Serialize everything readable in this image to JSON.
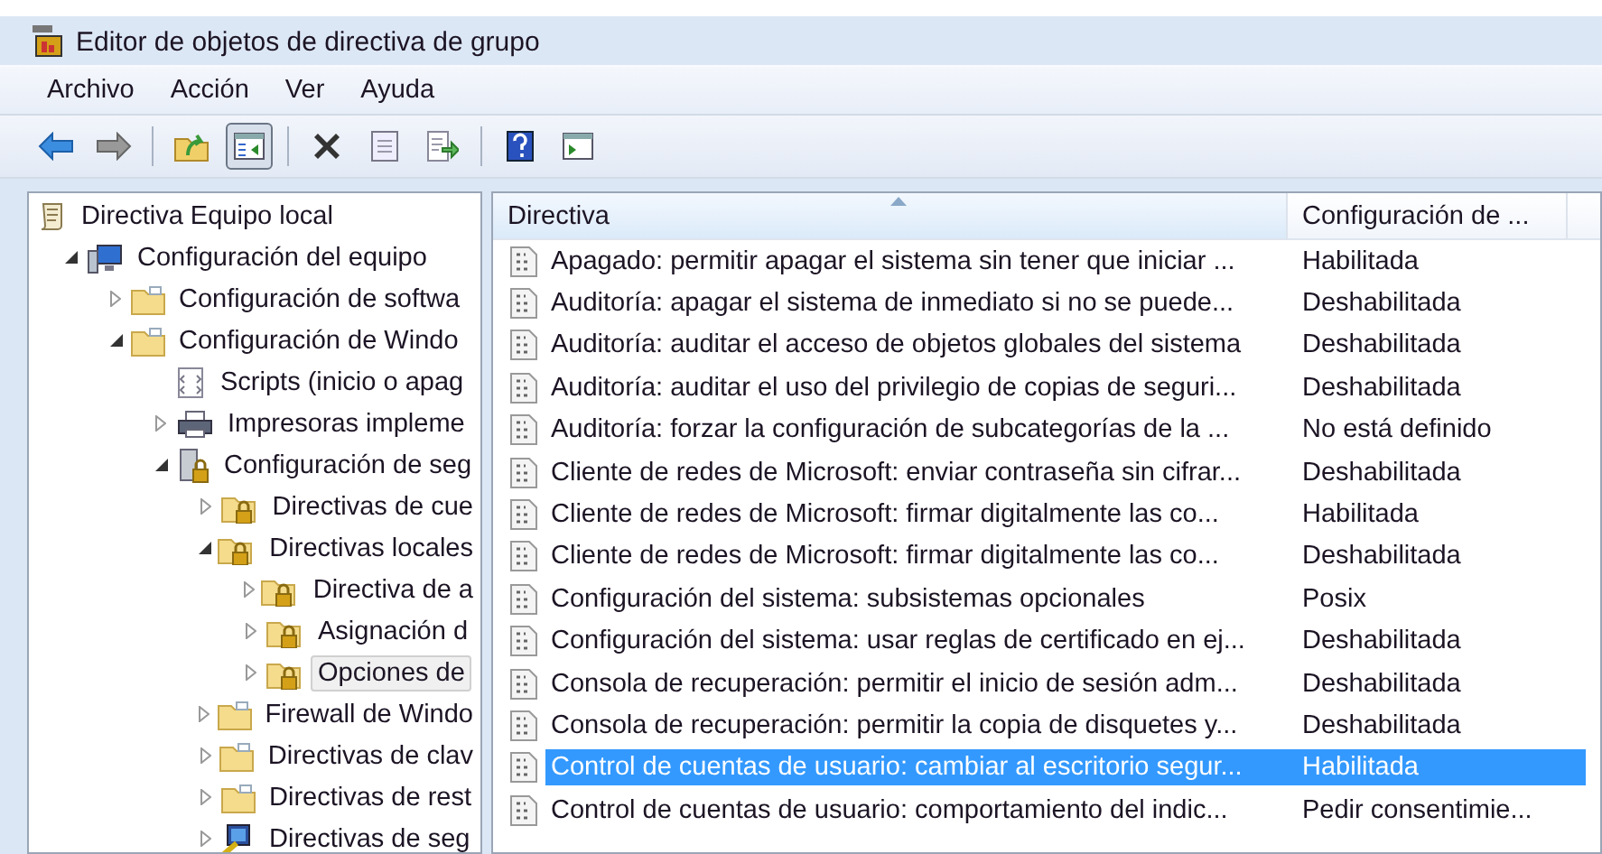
{
  "window": {
    "title": "Editor de objetos de directiva de grupo"
  },
  "menu": [
    "Archivo",
    "Acción",
    "Ver",
    "Ayuda"
  ],
  "toolbar": [
    {
      "kind": "back",
      "pressed": false
    },
    {
      "kind": "forward",
      "pressed": false
    },
    {
      "kind": "sep"
    },
    {
      "kind": "up",
      "pressed": false
    },
    {
      "kind": "tree",
      "pressed": true
    },
    {
      "kind": "sep"
    },
    {
      "kind": "delete",
      "pressed": false
    },
    {
      "kind": "properties",
      "pressed": false
    },
    {
      "kind": "export",
      "pressed": false
    },
    {
      "kind": "sep"
    },
    {
      "kind": "help",
      "pressed": false
    },
    {
      "kind": "view",
      "pressed": false
    }
  ],
  "tree": [
    {
      "label": "Directiva Equipo local",
      "kind": "scroll",
      "selected": false,
      "children": [
        {
          "label": "Configuración del equipo",
          "kind": "computer",
          "expanded": true,
          "selected": false,
          "children": [
            {
              "label": "Configuración de softwa",
              "kind": "folder",
              "expanded": false,
              "selected": false
            },
            {
              "label": "Configuración de Windo",
              "kind": "folder",
              "expanded": true,
              "selected": false,
              "children": [
                {
                  "label": "Scripts (inicio o apag",
                  "kind": "script",
                  "selected": false
                },
                {
                  "label": "Impresoras impleme",
                  "kind": "printer",
                  "expanded": false,
                  "selected": false
                },
                {
                  "label": "Configuración de seg",
                  "kind": "server",
                  "expanded": true,
                  "selected": false,
                  "children": [
                    {
                      "label": "Directivas de cue",
                      "kind": "lockfolder",
                      "expanded": false,
                      "selected": false
                    },
                    {
                      "label": "Directivas locales",
                      "kind": "lockfolder",
                      "expanded": true,
                      "selected": false,
                      "children": [
                        {
                          "label": "Directiva de a",
                          "kind": "lockfolder",
                          "expanded": false,
                          "selected": false
                        },
                        {
                          "label": "Asignación d",
                          "kind": "lockfolder",
                          "expanded": false,
                          "selected": false
                        },
                        {
                          "label": "Opciones de",
                          "kind": "lockfolder",
                          "expanded": false,
                          "selected": true
                        }
                      ]
                    },
                    {
                      "label": "Firewall de Windo",
                      "kind": "folder",
                      "expanded": false,
                      "selected": false
                    },
                    {
                      "label": "Directivas de clav",
                      "kind": "folder",
                      "expanded": false,
                      "selected": false
                    },
                    {
                      "label": "Directivas de rest",
                      "kind": "folder",
                      "expanded": false,
                      "selected": false
                    },
                    {
                      "label": "Directivas de seg",
                      "kind": "network",
                      "expanded": false,
                      "selected": false
                    }
                  ]
                }
              ]
            }
          ]
        }
      ]
    }
  ],
  "table": {
    "columns": [
      {
        "label": "Directiva",
        "sorted": true
      },
      {
        "label": "Configuración de ...",
        "sorted": false
      }
    ],
    "rows": [
      {
        "policy": "Apagado: permitir apagar el sistema sin tener que iniciar ...",
        "setting": "Habilitada",
        "selected": false
      },
      {
        "policy": "Auditoría: apagar el sistema de inmediato si no se puede...",
        "setting": "Deshabilitada",
        "selected": false
      },
      {
        "policy": "Auditoría: auditar el acceso de objetos globales del sistema",
        "setting": "Deshabilitada",
        "selected": false
      },
      {
        "policy": "Auditoría: auditar el uso del privilegio de copias de seguri...",
        "setting": "Deshabilitada",
        "selected": false
      },
      {
        "policy": "Auditoría: forzar la configuración de subcategorías de la ...",
        "setting": "No está definido",
        "selected": false
      },
      {
        "policy": "Cliente de redes de Microsoft: enviar contraseña sin cifrar...",
        "setting": "Deshabilitada",
        "selected": false
      },
      {
        "policy": "Cliente de redes de Microsoft: firmar digitalmente las co...",
        "setting": "Habilitada",
        "selected": false
      },
      {
        "policy": "Cliente de redes de Microsoft: firmar digitalmente las co...",
        "setting": "Deshabilitada",
        "selected": false
      },
      {
        "policy": "Configuración del sistema: subsistemas opcionales",
        "setting": "Posix",
        "selected": false
      },
      {
        "policy": "Configuración del sistema: usar reglas de certificado en ej...",
        "setting": "Deshabilitada",
        "selected": false
      },
      {
        "policy": "Consola de recuperación: permitir el inicio de sesión adm...",
        "setting": "Deshabilitada",
        "selected": false
      },
      {
        "policy": "Consola de recuperación: permitir la copia de disquetes y...",
        "setting": "Deshabilitada",
        "selected": false
      },
      {
        "policy": "Control de cuentas de usuario: cambiar al escritorio segur...",
        "setting": "Habilitada",
        "selected": true
      },
      {
        "policy": "Control de cuentas de usuario: comportamiento del indic...",
        "setting": "Pedir consentimie...",
        "selected": false
      }
    ]
  }
}
